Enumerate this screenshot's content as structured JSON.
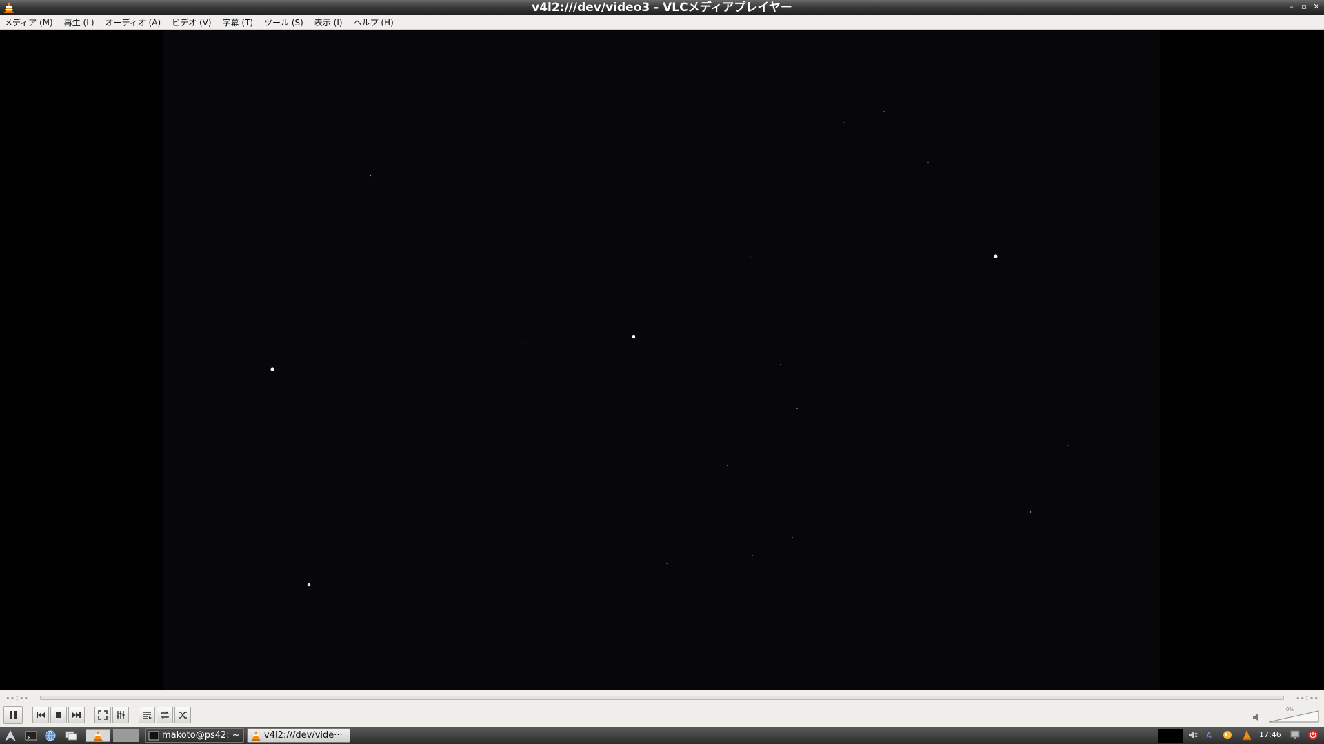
{
  "window": {
    "title": "v4l2:///dev/video3 - VLCメディアプレイヤー"
  },
  "menubar": {
    "items": [
      {
        "label": "メディア (M)"
      },
      {
        "label": "再生 (L)"
      },
      {
        "label": "オーディオ (A)"
      },
      {
        "label": "ビデオ (V)"
      },
      {
        "label": "字幕 (T)"
      },
      {
        "label": "ツール (S)"
      },
      {
        "label": "表示 (I)"
      },
      {
        "label": "ヘルプ (H)"
      }
    ]
  },
  "playback": {
    "elapsed": "--:--",
    "total": "--:--",
    "volume_percent": "0%"
  },
  "taskbar": {
    "tasks": [
      {
        "label": "makoto@ps42: ~"
      },
      {
        "label": "v4l2:///dev/vide···"
      }
    ],
    "clock": "17:46"
  },
  "colors": {
    "vlc_orange": "#f28a16",
    "video_bg": "#07070a",
    "menubar_bg": "#f0efed"
  }
}
